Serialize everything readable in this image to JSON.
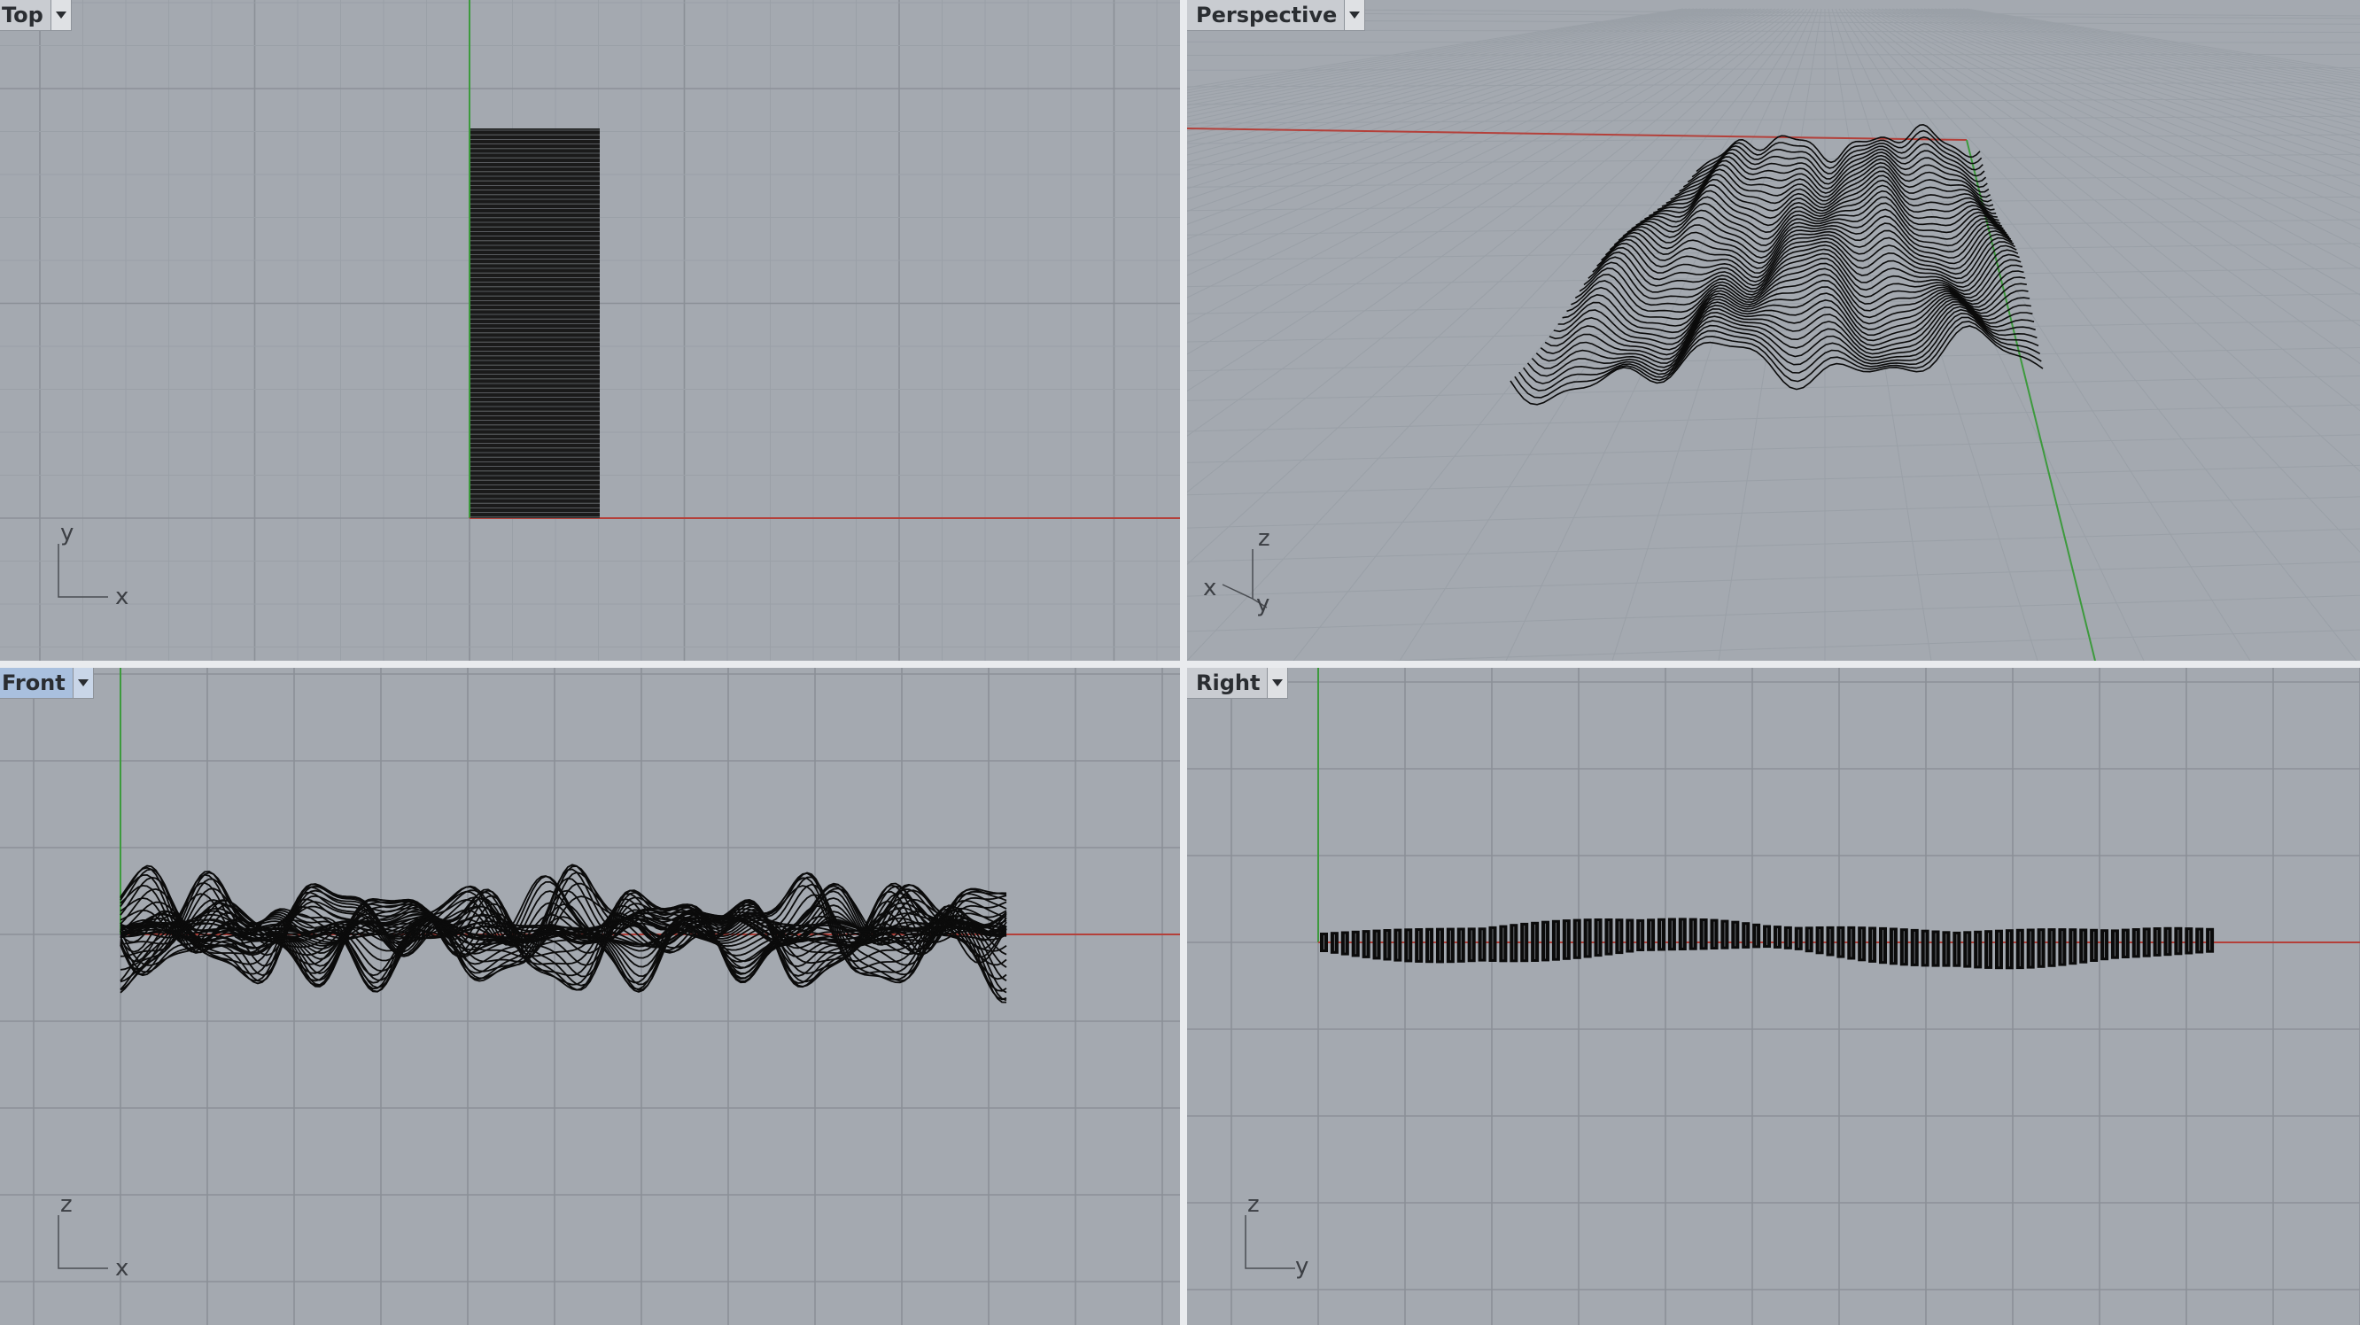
{
  "viewports": {
    "top": {
      "label": "Top",
      "axes": [
        "y",
        "x"
      ],
      "active": false
    },
    "perspective": {
      "label": "Perspective",
      "axes": [
        "z",
        "x",
        "y"
      ],
      "active": false
    },
    "front": {
      "label": "Front",
      "axes": [
        "z",
        "x"
      ],
      "active": true
    },
    "right": {
      "label": "Right",
      "axes": [
        "z",
        "y"
      ],
      "active": false
    }
  },
  "icons": {
    "viewport_menu": "triangle-down-icon"
  },
  "colors": {
    "viewport_bg": "#a4a9b0",
    "grid_minor": "#9aa0a7",
    "grid_major": "#8b9097",
    "x_axis": "#b4403a",
    "y_axis": "#3d9a3d",
    "geometry": "#0b0b0b",
    "active_tab": "#a9c0de"
  }
}
